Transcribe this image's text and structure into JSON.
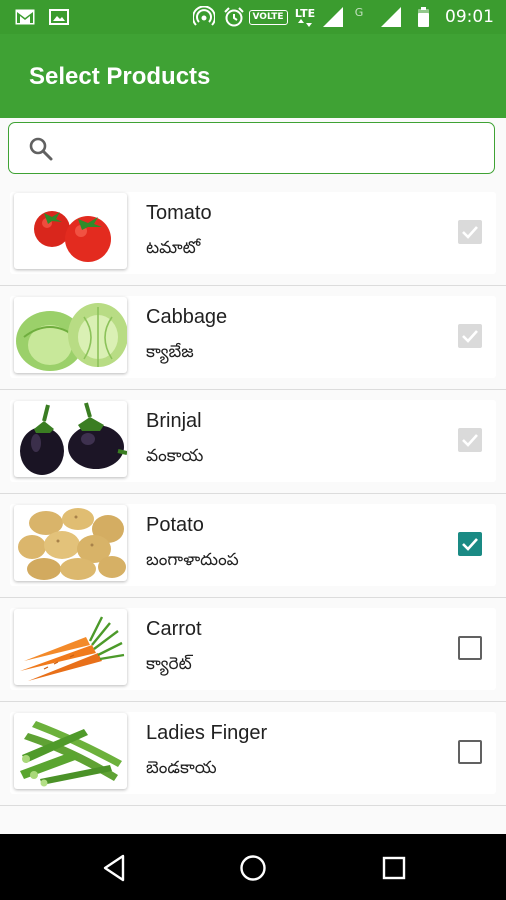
{
  "status_bar": {
    "time": "09:01",
    "volte": "VOLTE",
    "lte": "LTE",
    "g": "G",
    "icons": [
      "gmail-icon",
      "gallery-icon",
      "hotspot-icon",
      "alarm-icon",
      "volte-icon",
      "lte-signal-icon",
      "g-signal-icon",
      "battery-icon"
    ]
  },
  "app_bar": {
    "title": "Select Products"
  },
  "search": {
    "value": "",
    "placeholder": "",
    "icon": "search-icon"
  },
  "products": [
    {
      "name": "Tomato",
      "local_name": "టమాటో",
      "state": "disabled-checked",
      "image": "tomato"
    },
    {
      "name": "Cabbage",
      "local_name": "క్యాబేజ",
      "state": "disabled-checked",
      "image": "cabbage"
    },
    {
      "name": "Brinjal",
      "local_name": "వంకాయ",
      "state": "disabled-checked",
      "image": "brinjal"
    },
    {
      "name": "Potato",
      "local_name": "బంగాళాదుంప",
      "state": "checked",
      "image": "potato"
    },
    {
      "name": "Carrot",
      "local_name": "క్యారెట్",
      "state": "unchecked",
      "image": "carrot"
    },
    {
      "name": "Ladies Finger",
      "local_name": "బెండకాయ",
      "state": "unchecked",
      "image": "ladies-finger"
    }
  ],
  "colors": {
    "status_bar": "#3b9c2f",
    "app_bar": "#3fa234",
    "checkbox_checked": "#1a8a84",
    "checkbox_disabled": "#dadada"
  },
  "nav_bar": {
    "icons": [
      "back-icon",
      "home-icon",
      "recents-icon"
    ]
  }
}
